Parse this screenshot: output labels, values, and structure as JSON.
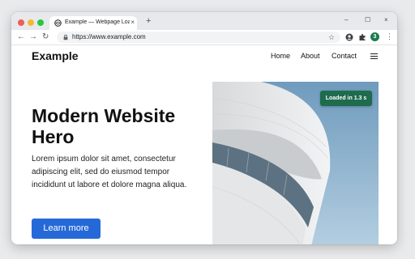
{
  "browser": {
    "tab_title": "Example — Webpage Load X",
    "tab_close": "×",
    "new_tab": "+",
    "window_controls": {
      "minimize": "–",
      "maximize": "☐",
      "close": "×"
    },
    "nav": {
      "back": "←",
      "forward": "→",
      "reload": "↻"
    },
    "url": "https://www.example.com",
    "bookmark": "☆",
    "profile_initial": "3",
    "menu": "⋮",
    "icons": [
      "favicon-icon",
      "lock-icon",
      "account-icon",
      "puzzle-icon"
    ]
  },
  "site": {
    "brand": "Example",
    "nav": {
      "home": "Home",
      "about": "About",
      "contact": "Contact"
    },
    "hero": {
      "title": "Modern Website Hero",
      "text": "Lorem ipsum dolor sit amet, consectetur adipiscing elit, sed do eiusmod tempor incididunt ut labore et dolore magna aliqua.",
      "cta": "Learn more"
    },
    "badge": "Loaded in 1.3 s"
  },
  "colors": {
    "accent": "#2569d8",
    "badge": "#1e6b4d",
    "profile": "#1e7b4d",
    "sky": "#8fb3cc"
  }
}
